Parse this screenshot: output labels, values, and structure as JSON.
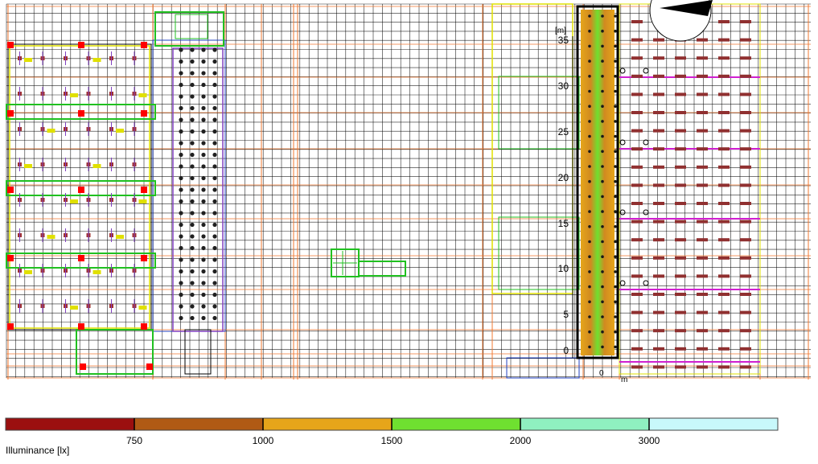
{
  "plan": {
    "unit_label": "[m]",
    "axis_ticks": [
      "35",
      "30",
      "25",
      "20",
      "15",
      "10",
      "5",
      "0"
    ],
    "origin_label": "0",
    "x_unit_label": "m"
  },
  "legend": {
    "title": "Illuminance [lx]",
    "bands": [
      {
        "color": "#9b0f0f"
      },
      {
        "color": "#b05a14"
      },
      {
        "color": "#e6a51a"
      },
      {
        "color": "#6fe030"
      },
      {
        "color": "#8ff0c0"
      },
      {
        "color": "#c8f8fb"
      }
    ],
    "boundaries": [
      "750",
      "1000",
      "1500",
      "2000",
      "3000"
    ]
  },
  "colors": {
    "grid": "#000000",
    "orange_line": "#f07830",
    "yellow_line": "#e0e000",
    "green_line": "#20c020",
    "magenta_line": "#d020d0",
    "red_fill": "#ff0000"
  }
}
